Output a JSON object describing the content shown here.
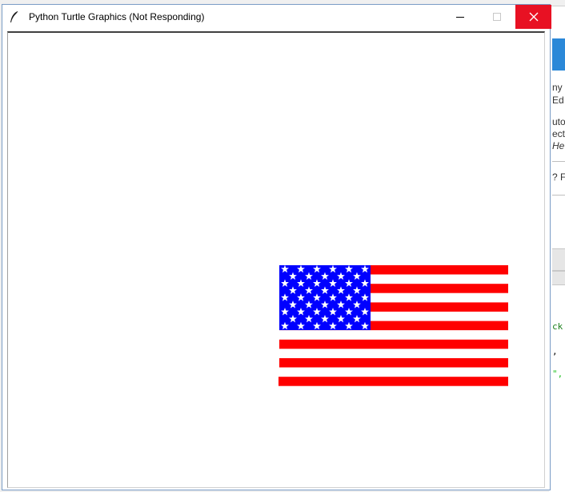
{
  "window": {
    "title": "Python Turtle Graphics (Not Responding)",
    "icon": "feather-icon",
    "controls": {
      "minimize_icon": "minimize-icon",
      "maximize_icon": "maximize-icon",
      "close_icon": "close-icon"
    },
    "close_color": "#e81123"
  },
  "background_window": {
    "menu_fragment": "Help",
    "text_fragments": [
      "ny",
      "Ed",
      "uto",
      "ect",
      "He",
      "? F"
    ],
    "code_fragments": [
      {
        "text": "ck",
        "color": "#1a7f1a"
      },
      {
        "text": ",",
        "color": "#000000"
      },
      {
        "text": "\",",
        "color": "#22c022"
      }
    ],
    "accent": "#2b88d8"
  },
  "canvas": {
    "background": "#ffffff",
    "drawing": {
      "name": "american-flag",
      "stripe_color": "#ff0000",
      "canton_color": "#0000ff",
      "star_color": "#ffffff",
      "red_stripe_count": 7,
      "star_count": 50,
      "star_rows": [
        6,
        5,
        6,
        5,
        6,
        5,
        6,
        5,
        6
      ]
    }
  }
}
